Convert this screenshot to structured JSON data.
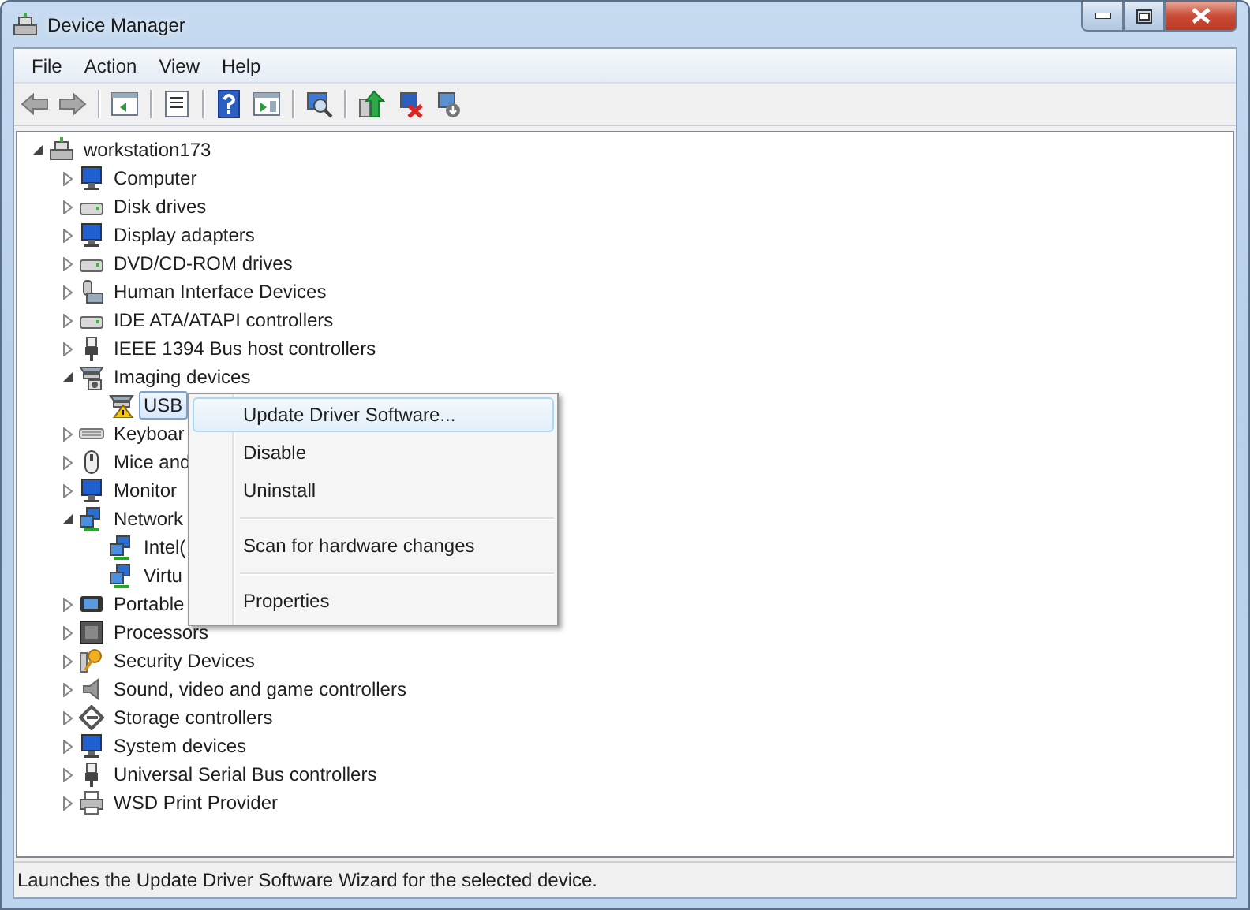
{
  "window": {
    "title": "Device Manager"
  },
  "menu": [
    "File",
    "Action",
    "View",
    "Help"
  ],
  "toolbar": [
    {
      "kind": "back",
      "disabled": true
    },
    {
      "kind": "forward",
      "disabled": true
    },
    {
      "kind": "separator"
    },
    {
      "kind": "tree"
    },
    {
      "kind": "separator"
    },
    {
      "kind": "properties"
    },
    {
      "kind": "separator"
    },
    {
      "kind": "help"
    },
    {
      "kind": "pane"
    },
    {
      "kind": "separator"
    },
    {
      "kind": "scan"
    },
    {
      "kind": "separator"
    },
    {
      "kind": "update"
    },
    {
      "kind": "uninstall"
    },
    {
      "kind": "disable"
    }
  ],
  "tree": {
    "label": "workstation173",
    "kind": "computer",
    "expanded": true,
    "selected": false,
    "children": [
      {
        "label": "Computer",
        "kind": "monitor",
        "expanded": false,
        "selected": false
      },
      {
        "label": "Disk drives",
        "kind": "drive",
        "expanded": false,
        "selected": false
      },
      {
        "label": "Display adapters",
        "kind": "monitor",
        "expanded": false,
        "selected": false
      },
      {
        "label": "DVD/CD-ROM drives",
        "kind": "drive",
        "expanded": false,
        "selected": false
      },
      {
        "label": "Human Interface Devices",
        "kind": "hid",
        "expanded": false,
        "selected": false
      },
      {
        "label": "IDE ATA/ATAPI controllers",
        "kind": "drive",
        "expanded": false,
        "selected": false
      },
      {
        "label": "IEEE 1394 Bus host controllers",
        "kind": "plug",
        "expanded": false,
        "selected": false
      },
      {
        "label": "Imaging devices",
        "kind": "scanner",
        "expanded": true,
        "selected": false,
        "children": [
          {
            "label": "USB",
            "kind": "warning",
            "selected": true
          }
        ]
      },
      {
        "label": "Keyboar",
        "kind": "keyboard",
        "expanded": false,
        "selected": false
      },
      {
        "label": "Mice and",
        "kind": "mouse",
        "expanded": false,
        "selected": false
      },
      {
        "label": "Monitor",
        "kind": "monitor",
        "expanded": false,
        "selected": false
      },
      {
        "label": "Network",
        "kind": "network",
        "expanded": true,
        "selected": false,
        "children": [
          {
            "label": "Intel(",
            "kind": "network",
            "selected": false
          },
          {
            "label": "Virtu",
            "kind": "network",
            "selected": false
          }
        ]
      },
      {
        "label": "Portable",
        "kind": "portable",
        "expanded": false,
        "selected": false
      },
      {
        "label": "Processors",
        "kind": "chip",
        "expanded": false,
        "selected": false
      },
      {
        "label": "Security Devices",
        "kind": "key",
        "expanded": false,
        "selected": false
      },
      {
        "label": "Sound, video and game controllers",
        "kind": "speaker",
        "expanded": false,
        "selected": false
      },
      {
        "label": "Storage controllers",
        "kind": "storage",
        "expanded": false,
        "selected": false
      },
      {
        "label": "System devices",
        "kind": "monitor",
        "expanded": false,
        "selected": false
      },
      {
        "label": "Universal Serial Bus controllers",
        "kind": "plug",
        "expanded": false,
        "selected": false
      },
      {
        "label": "WSD Print Provider",
        "kind": "printer",
        "expanded": false,
        "selected": false
      }
    ]
  },
  "context_menu": [
    {
      "kind": "item",
      "label": "Update Driver Software...",
      "selected": true
    },
    {
      "kind": "item",
      "label": "Disable",
      "selected": false
    },
    {
      "kind": "item",
      "label": "Uninstall",
      "selected": false
    },
    {
      "kind": "separator"
    },
    {
      "kind": "item",
      "label": "Scan for hardware changes",
      "selected": false
    },
    {
      "kind": "separator"
    },
    {
      "kind": "item",
      "label": "Properties",
      "selected": false
    }
  ],
  "status_bar": "Launches the Update Driver Software Wizard for the selected device."
}
